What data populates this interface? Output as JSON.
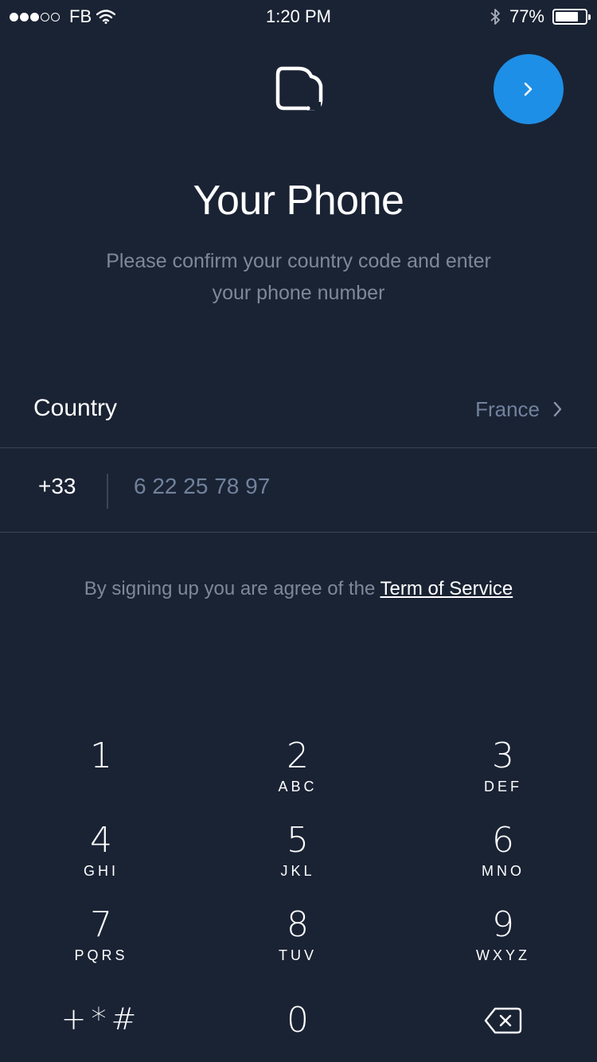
{
  "status": {
    "carrier": "FB",
    "time": "1:20 PM",
    "battery": "77%",
    "battery_level": 0.77
  },
  "header": {
    "title": "Your Phone",
    "subtitle": "Please confirm your country code and enter your phone number"
  },
  "country": {
    "label": "Country",
    "value": "France"
  },
  "phone": {
    "code": "+33",
    "number": "6 22 25 78 97"
  },
  "terms": {
    "text": "By signing up you are agree of the ",
    "link": "Term of Service"
  },
  "keypad": {
    "keys": [
      {
        "digit": "1",
        "letters": ""
      },
      {
        "digit": "2",
        "letters": "ABC"
      },
      {
        "digit": "3",
        "letters": "DEF"
      },
      {
        "digit": "4",
        "letters": "GHI"
      },
      {
        "digit": "5",
        "letters": "JKL"
      },
      {
        "digit": "6",
        "letters": "MNO"
      },
      {
        "digit": "7",
        "letters": "PQRS"
      },
      {
        "digit": "8",
        "letters": "TUV"
      },
      {
        "digit": "9",
        "letters": "WXYZ"
      },
      {
        "digit": "0",
        "letters": ""
      }
    ],
    "symbols": "+*#",
    "delete_icon": "backspace-icon"
  },
  "colors": {
    "background": "#1a2334",
    "accent": "#1e8fe6",
    "muted_text": "#7f8898",
    "value_text": "#71829c",
    "divider": "#3a4556"
  }
}
